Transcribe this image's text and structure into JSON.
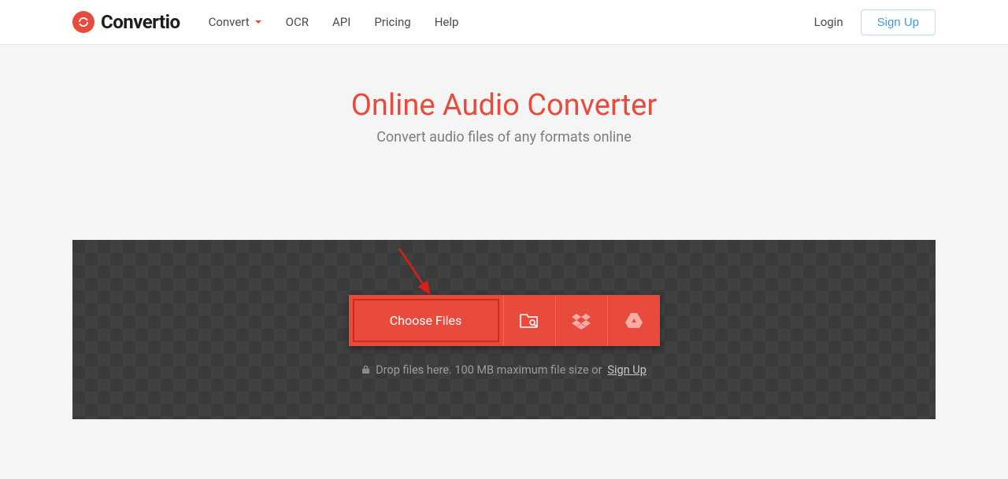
{
  "brand": {
    "name": "Convertio"
  },
  "nav": {
    "convert": "Convert",
    "ocr": "OCR",
    "api": "API",
    "pricing": "Pricing",
    "help": "Help"
  },
  "auth": {
    "login": "Login",
    "signup": "Sign Up"
  },
  "hero": {
    "title": "Online Audio Converter",
    "subtitle": "Convert audio files of any formats online"
  },
  "upload": {
    "choose": "Choose Files",
    "note_prefix": "Drop files here. 100 MB maximum file size or ",
    "note_link": "Sign Up"
  },
  "icons": {
    "logo": "convertio-logo",
    "caret": "chevron-down-icon",
    "folder": "folder-search-icon",
    "dropbox": "dropbox-icon",
    "gdrive": "google-drive-icon",
    "lock": "lock-icon"
  }
}
